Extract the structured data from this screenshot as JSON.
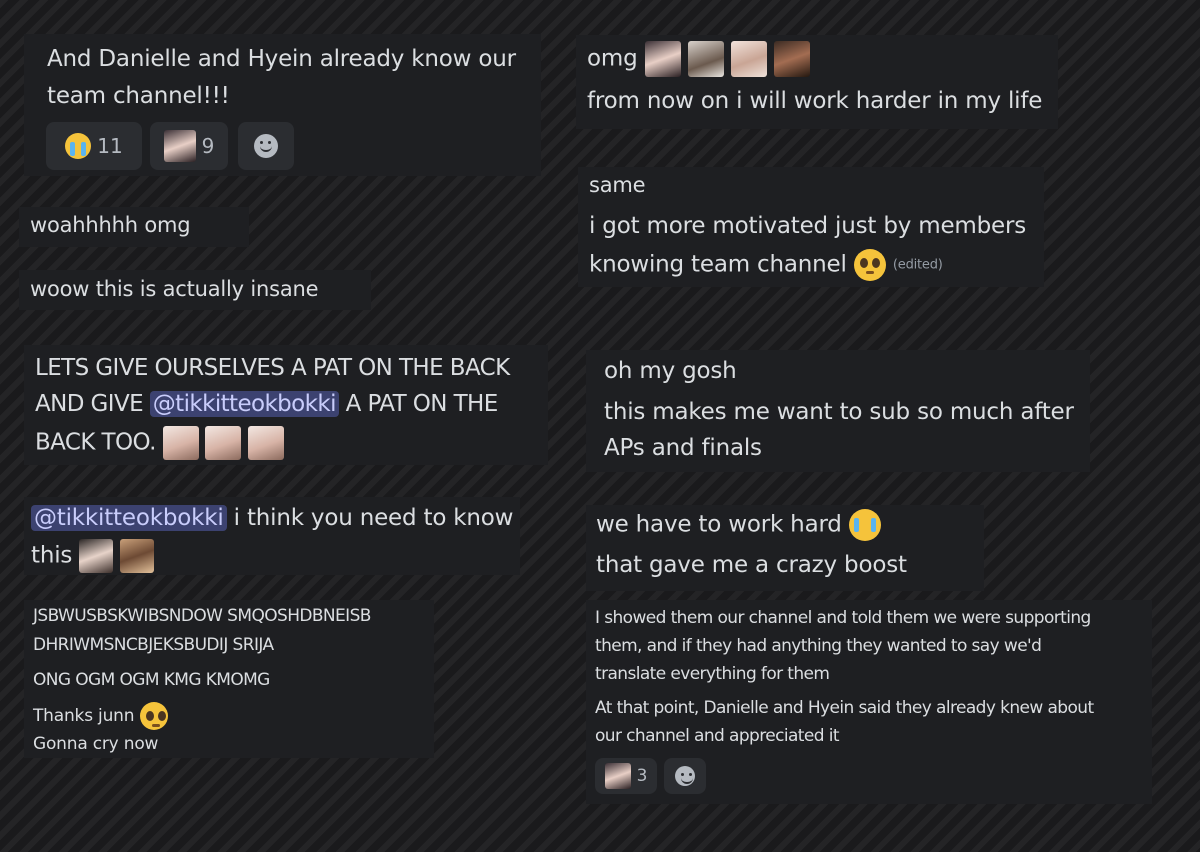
{
  "cards": {
    "c1": {
      "line1": "And Danielle and Hyein already know our",
      "line2": "team channel!!!",
      "reactions": [
        "11",
        "9"
      ]
    },
    "c2": {
      "text": "woahhhhh omg"
    },
    "c3": {
      "text": "woow this is actually insane"
    },
    "c4": {
      "line1": "LETS GIVE OURSELVES A PAT ON THE BACK",
      "line2_a": "AND GIVE",
      "mention": "@tikkitteokbokki",
      "line2_b": "A PAT ON THE",
      "line3": "BACK TOO."
    },
    "c5": {
      "mention": "@tikkitteokbokki",
      "line1": "i think you need to know",
      "line2": "this"
    },
    "c6": {
      "line1": "JSBWUSBSKWIBSNDOW SMQOSHDBNEISB",
      "line2": "DHRIWMSNCBJEKSBUDIJ SRIJA",
      "line3": "ONG OGM OGM KMG KMOMG",
      "line4": "Thanks junn",
      "line5": "Gonna cry now"
    },
    "c7": {
      "line1": "omg",
      "line2": "from now on  i will work harder  in my life"
    },
    "c8": {
      "line1": "same",
      "line2": "i got more motivated just by members",
      "line3": "knowing team channel",
      "edited": "(edited)"
    },
    "c9": {
      "line1": "oh my gosh",
      "line2": "this makes me want to sub so much after",
      "line3": "APs and finals"
    },
    "c10": {
      "line1": "we have to work hard",
      "line2": "that gave me a crazy boost"
    },
    "c11": {
      "line1": "I showed them our channel and told them we were supporting",
      "line2": "them, and if they had anything they wanted to say we'd",
      "line3": "translate everything for them",
      "line4": "At that point, Danielle and Hyein said they already knew about",
      "line5": "our channel and appreciated it",
      "reaction": "3"
    }
  },
  "icons": {
    "crying": "loudly-crying-face-emoji",
    "pleading": "pleading-face-emoji",
    "add_reaction": "smiley-icon"
  },
  "colors": {
    "card_bg": "#1e1f22",
    "mention_bg": "#3c4270",
    "mention_text": "#c9cdfb",
    "reaction_bg": "#2b2d31"
  }
}
